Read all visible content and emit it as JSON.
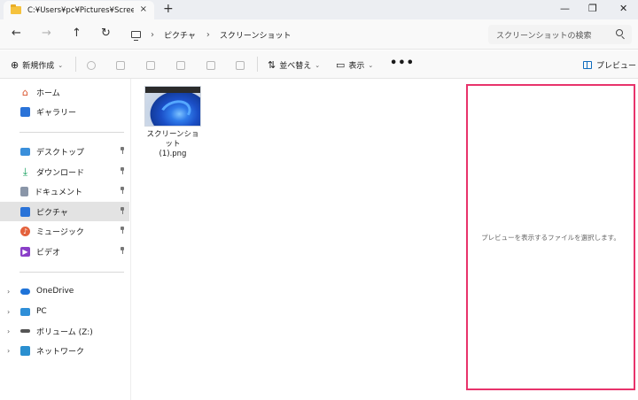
{
  "titlebar": {
    "tab_title": "C:¥Users¥pc¥Pictures¥Screens",
    "tab_close": "×",
    "new_tab": "+",
    "minimize": "—",
    "maximize": "❐",
    "close": "✕"
  },
  "address": {
    "back": "←",
    "forward": "→",
    "up": "↑",
    "refresh": "↻",
    "breadcrumbs": [
      "ピクチャ",
      "スクリーンショット"
    ],
    "separator": "›",
    "search_placeholder": "スクリーンショットの検索"
  },
  "toolbar": {
    "new_label": "新規作成",
    "sort_label": "並べ替え",
    "view_label": "表示",
    "more_label": "•••",
    "preview_label": "プレビュー"
  },
  "sidebar": {
    "items": [
      {
        "label": "ホーム",
        "icon": "home-icon"
      },
      {
        "label": "ギャラリー",
        "icon": "gallery-icon"
      },
      {
        "label": "デスクトップ",
        "icon": "desktop-icon",
        "pinned": true
      },
      {
        "label": "ダウンロード",
        "icon": "download-icon",
        "pinned": true
      },
      {
        "label": "ドキュメント",
        "icon": "document-icon",
        "pinned": true
      },
      {
        "label": "ピクチャ",
        "icon": "pictures-icon",
        "pinned": true,
        "selected": true
      },
      {
        "label": "ミュージック",
        "icon": "music-icon",
        "pinned": true
      },
      {
        "label": "ビデオ",
        "icon": "video-icon",
        "pinned": true
      },
      {
        "label": "OneDrive",
        "icon": "onedrive-icon"
      },
      {
        "label": "PC",
        "icon": "pc-icon"
      },
      {
        "label": "ボリューム (Z:)",
        "icon": "drive-icon"
      },
      {
        "label": "ネットワーク",
        "icon": "network-icon"
      }
    ]
  },
  "files": [
    {
      "name_line1": "スクリーンショット",
      "name_line2": "(1).png"
    }
  ],
  "preview": {
    "message": "プレビューを表示するファイルを選択します。"
  },
  "colors": {
    "accent": "#0f6cbd",
    "preview_border": "#e8336b",
    "selected_bg": "#e3e3e3"
  }
}
